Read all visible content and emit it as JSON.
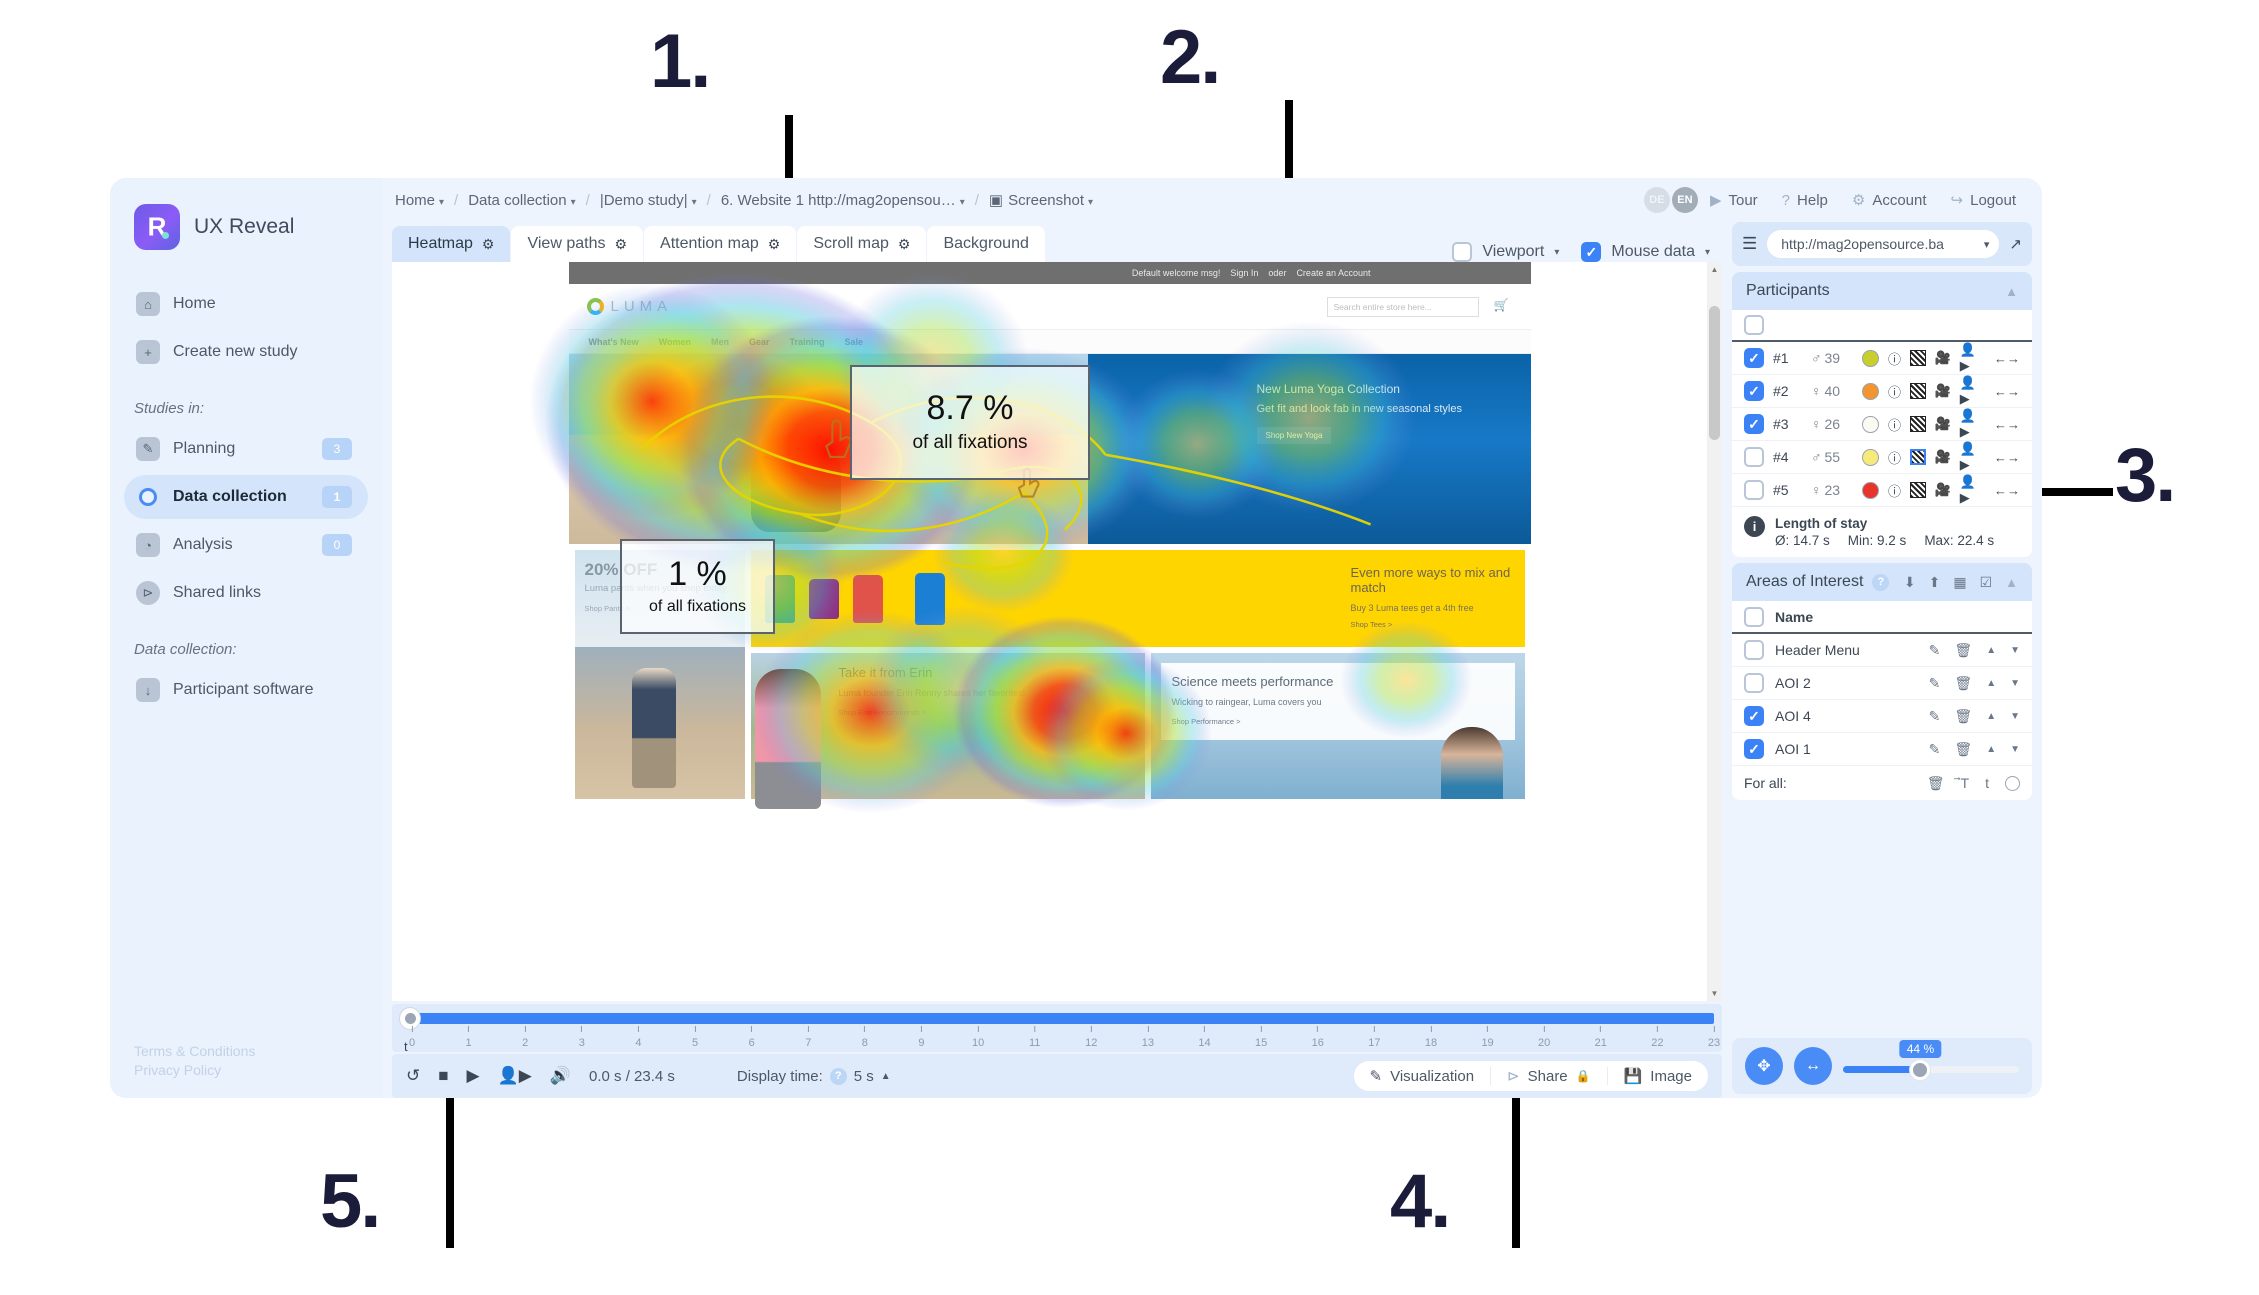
{
  "annotations": [
    {
      "num": "1."
    },
    {
      "num": "2."
    },
    {
      "num": "3."
    },
    {
      "num": "4."
    },
    {
      "num": "5."
    }
  ],
  "sidebar": {
    "brand": "UX Reveal",
    "items": [
      {
        "label": "Home",
        "icon": "home-icon",
        "badge": null,
        "active": false
      },
      {
        "label": "Create new study",
        "icon": "plus-icon",
        "badge": null,
        "active": false
      }
    ],
    "section_studies": "Studies in:",
    "studies": [
      {
        "label": "Planning",
        "icon": "planning-icon",
        "badge": "3",
        "active": false
      },
      {
        "label": "Data collection",
        "icon": "circle-icon",
        "badge": "1",
        "active": true
      },
      {
        "label": "Analysis",
        "icon": "analysis-icon",
        "badge": "0",
        "active": false
      },
      {
        "label": "Shared links",
        "icon": "share-icon",
        "badge": null,
        "active": false
      }
    ],
    "section_datacollection": "Data collection:",
    "tools": [
      {
        "label": "Participant software",
        "icon": "download-icon",
        "badge": null,
        "active": false
      }
    ],
    "legal": [
      "Terms & Conditions",
      "Privacy Policy"
    ]
  },
  "topbar": {
    "breadcrumbs": [
      {
        "label": "Home",
        "caret": true
      },
      {
        "label": "Data collection",
        "caret": true
      },
      {
        "label": "|Demo study|",
        "caret": true
      },
      {
        "label": "6. Website 1 http://mag2opensou…",
        "caret": true
      },
      {
        "label": "Screenshot",
        "caret": true,
        "icon": "camera-icon"
      }
    ],
    "lang_de": "DE",
    "lang_en": "EN",
    "actions": [
      {
        "label": "Tour",
        "icon": "play-circle-icon"
      },
      {
        "label": "Help",
        "icon": "question-circle-icon"
      },
      {
        "label": "Account",
        "icon": "gear-icon"
      },
      {
        "label": "Logout",
        "icon": "logout-icon"
      }
    ]
  },
  "tabs": [
    {
      "label": "Heatmap",
      "gear": true,
      "active": true
    },
    {
      "label": "View paths",
      "gear": true,
      "active": false
    },
    {
      "label": "Attention map",
      "gear": true,
      "active": false
    },
    {
      "label": "Scroll map",
      "gear": true,
      "active": false
    },
    {
      "label": "Background",
      "gear": false,
      "active": false
    }
  ],
  "view_toggles": [
    {
      "label": "Viewport",
      "checked": false
    },
    {
      "label": "Mouse data",
      "checked": true
    }
  ],
  "website": {
    "top_strip": [
      "Default welcome msg!",
      "Sign In",
      "oder",
      "Create an Account"
    ],
    "logo": "LUMA",
    "search_placeholder": "Search entire store here...",
    "nav": [
      "What's New",
      "Women",
      "Men",
      "Gear",
      "Training",
      "Sale"
    ],
    "hero": {
      "title": "New Luma Yoga Collection",
      "text": "Get fit and look fab in new seasonal styles",
      "button": "Shop New Yoga"
    },
    "promo": {
      "big": "20% OFF",
      "text": "Luma pants when you shop today",
      "link": "Shop Pants >"
    },
    "tees": {
      "title": "Even more ways to mix and match",
      "text": "Buy 3 Luma tees get a 4th free",
      "link": "Shop Tees >"
    },
    "erin": {
      "title": "Take it from Erin",
      "text": "Luma founder Erin Renny shares her favorites!",
      "link": "Shop Erin Recommends >"
    },
    "science": {
      "title": "Science meets performance",
      "text": "Wicking to raingear, Luma covers you",
      "link": "Shop Performance >"
    }
  },
  "aoi_overlays": [
    {
      "name": "aoi-1-overlay",
      "percent": "8.7 %",
      "sub": "of all fixations"
    },
    {
      "name": "aoi-4-overlay",
      "percent": "1 %",
      "sub": "of all fixations"
    }
  ],
  "timeline": {
    "ticks": [
      "0",
      "1",
      "2",
      "3",
      "4",
      "5",
      "6",
      "7",
      "8",
      "9",
      "10",
      "11",
      "12",
      "13",
      "14",
      "15",
      "16",
      "17",
      "18",
      "19",
      "20",
      "21",
      "22",
      "23"
    ],
    "axis_label": "t"
  },
  "player": {
    "icons": [
      "reset-icon",
      "stop-icon",
      "play-icon",
      "participant-play-icon",
      "volume-icon"
    ],
    "time": "0.0 s / 23.4 s",
    "display_time_label": "Display time:",
    "display_time_value": "5 s",
    "buttons": [
      {
        "label": "Visualization",
        "icon": "brush-icon",
        "lock": false
      },
      {
        "label": "Share",
        "icon": "share-icon",
        "lock": true
      },
      {
        "label": "Image",
        "icon": "save-icon",
        "lock": false
      }
    ]
  },
  "right_panel": {
    "url_value": "http://mag2opensource.ba",
    "sitemap_icon": "sitemap-icon",
    "open_icon": "external-link-icon",
    "participants": {
      "title": "Participants",
      "select_all_checked": false,
      "rows": [
        {
          "id": "#1",
          "sex": "♂",
          "age": "39",
          "color": "#c8cf2c",
          "checked": true,
          "hatch_selected": false
        },
        {
          "id": "#2",
          "sex": "♀",
          "age": "40",
          "color": "#f29430",
          "checked": true,
          "hatch_selected": false
        },
        {
          "id": "#3",
          "sex": "♀",
          "age": "26",
          "color": "#fbfbf4",
          "checked": true,
          "hatch_selected": false
        },
        {
          "id": "#4",
          "sex": "♂",
          "age": "55",
          "color": "#f5ea7a",
          "checked": false,
          "hatch_selected": true
        },
        {
          "id": "#5",
          "sex": "♀",
          "age": "23",
          "color": "#e8342a",
          "checked": false,
          "hatch_selected": false
        }
      ],
      "length_of_stay": {
        "title": "Length of stay",
        "avg": "Ø: 14.7 s",
        "min": "Min: 9.2 s",
        "max": "Max: 22.4 s"
      }
    },
    "areas_of_interest": {
      "title": "Areas of Interest",
      "header_name": "Name",
      "header_checked": false,
      "rows": [
        {
          "name": "Header Menu",
          "checked": false
        },
        {
          "name": "AOI 2",
          "checked": false
        },
        {
          "name": "AOI 4",
          "checked": true
        },
        {
          "name": "AOI 1",
          "checked": true
        }
      ],
      "for_all_label": "For all:",
      "for_all_icons": [
        "trash-icon",
        "text-icon",
        "t-icon",
        "circle-icon"
      ]
    },
    "zoom": {
      "fit_icon": "fit-screen-icon",
      "fit_width_icon": "fit-width-icon",
      "value": "44 %",
      "percent": 44
    }
  },
  "colors": {
    "accent": "#3b82f6",
    "panel_bg": "#eef4fd",
    "sidebar_bg": "#eaf2fd",
    "tab_active": "#d3e4fb"
  }
}
